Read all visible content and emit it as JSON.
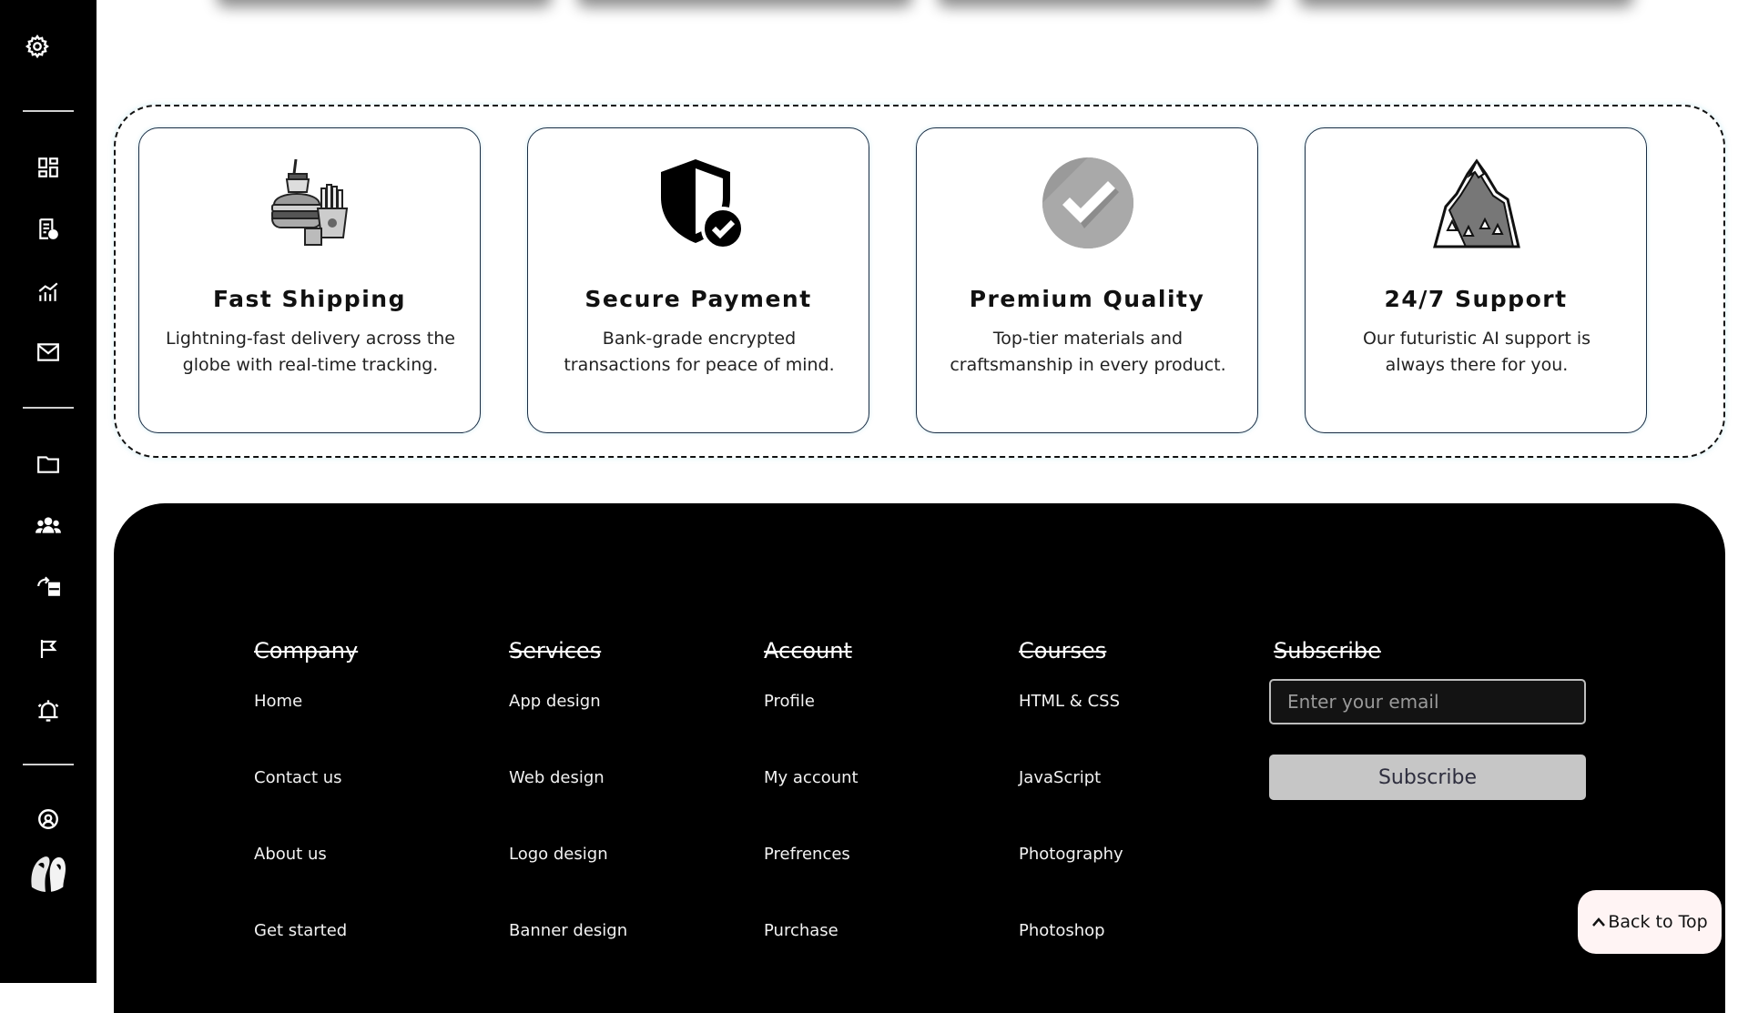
{
  "sidebar": {
    "icons": [
      "settings-icon",
      "dashboard-icon",
      "report-icon",
      "analytics-icon",
      "mail-icon",
      "folder-icon",
      "team-icon",
      "tasks-icon",
      "flag-icon",
      "alarm-icon",
      "support-icon"
    ],
    "avatar": "user-avatar"
  },
  "features": [
    {
      "icon": "fast-food-icon",
      "title": "Fast Shipping",
      "description": "Lightning-fast delivery across the globe with real-time tracking."
    },
    {
      "icon": "shield-check-icon",
      "title": "Secure Payment",
      "description": "Bank-grade encrypted transactions for peace of mind."
    },
    {
      "icon": "checkmark-circle-icon",
      "title": "Premium Quality",
      "description": "Top-tier materials and craftsmanship in every product."
    },
    {
      "icon": "mountain-icon",
      "title": "24/7 Support",
      "description": "Our futuristic AI support is always there for you."
    }
  ],
  "footer": {
    "columns": [
      {
        "heading": "Company",
        "links": [
          "Home",
          "Contact us",
          "About us",
          "Get started"
        ]
      },
      {
        "heading": "Services",
        "links": [
          "App design",
          "Web design",
          "Logo design",
          "Banner design"
        ]
      },
      {
        "heading": "Account",
        "links": [
          "Profile",
          "My account",
          "Prefrences",
          "Purchase"
        ]
      },
      {
        "heading": "Courses",
        "links": [
          "HTML & CSS",
          "JavaScript",
          "Photography",
          "Photoshop"
        ]
      }
    ],
    "subscribe": {
      "heading": "Subscribe",
      "placeholder": "Enter your email",
      "button_label": "Subscribe"
    }
  },
  "back_to_top": "Back to Top"
}
